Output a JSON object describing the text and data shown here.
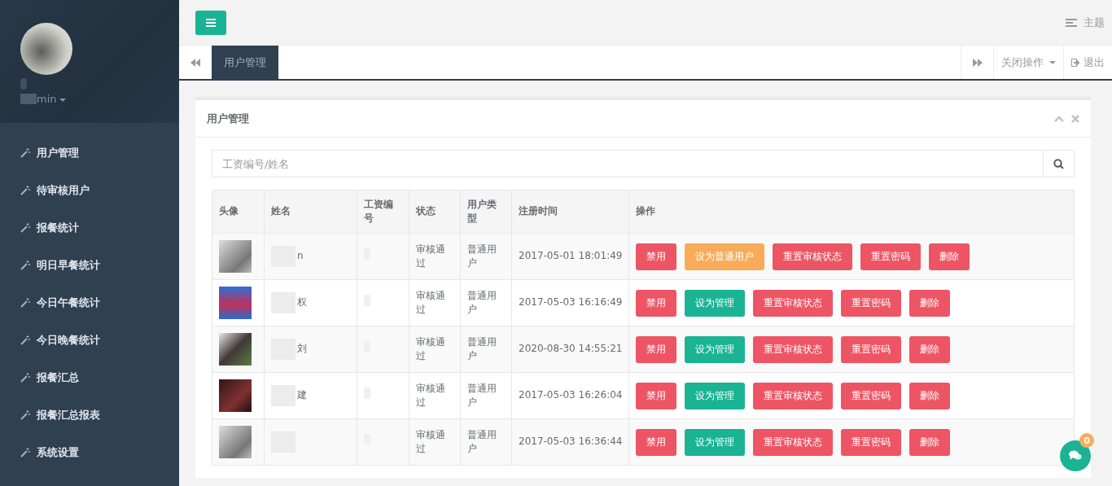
{
  "sidebar": {
    "username": "min",
    "menu": [
      {
        "label": "用户管理"
      },
      {
        "label": "待审核用户"
      },
      {
        "label": "报餐统计"
      },
      {
        "label": "明日早餐统计"
      },
      {
        "label": "今日午餐统计"
      },
      {
        "label": "今日晚餐统计"
      },
      {
        "label": "报餐汇总"
      },
      {
        "label": "报餐汇总报表"
      },
      {
        "label": "系统设置"
      }
    ]
  },
  "topbar": {
    "theme_label": "主题"
  },
  "tabs": [
    {
      "label": "用户管理",
      "selected": true
    }
  ],
  "tab_actions": {
    "close_ops": "关闭操作",
    "logout": "退出"
  },
  "panel": {
    "title": "用户管理",
    "search": {
      "placeholder": "工资编号/姓名"
    },
    "table": {
      "columns": [
        "头像",
        "姓名",
        "工资编号",
        "状态",
        "用户类型",
        "注册时间",
        "操作"
      ],
      "rows": [
        {
          "name": "n",
          "status": "审核通过",
          "type": "普通用户",
          "time": "2017-05-01 18:01:49",
          "actions": [
            {
              "label": "禁用",
              "kind": "danger"
            },
            {
              "label": "设为普通用户",
              "kind": "warning"
            },
            {
              "label": "重置审核状态",
              "kind": "danger"
            },
            {
              "label": "重置密码",
              "kind": "danger"
            },
            {
              "label": "删除",
              "kind": "danger"
            }
          ]
        },
        {
          "name": "权",
          "status": "审核通过",
          "type": "普通用户",
          "time": "2017-05-03 16:16:49",
          "actions": [
            {
              "label": "禁用",
              "kind": "danger"
            },
            {
              "label": "设为管理",
              "kind": "primary"
            },
            {
              "label": "重置审核状态",
              "kind": "danger"
            },
            {
              "label": "重置密码",
              "kind": "danger"
            },
            {
              "label": "删除",
              "kind": "danger"
            }
          ]
        },
        {
          "name": "刘",
          "status": "审核通过",
          "type": "普通用户",
          "time": "2020-08-30 14:55:21",
          "actions": [
            {
              "label": "禁用",
              "kind": "danger"
            },
            {
              "label": "设为管理",
              "kind": "primary"
            },
            {
              "label": "重置审核状态",
              "kind": "danger"
            },
            {
              "label": "重置密码",
              "kind": "danger"
            },
            {
              "label": "删除",
              "kind": "danger"
            }
          ]
        },
        {
          "name": "建",
          "status": "审核通过",
          "type": "普通用户",
          "time": "2017-05-03 16:26:04",
          "actions": [
            {
              "label": "禁用",
              "kind": "danger"
            },
            {
              "label": "设为管理",
              "kind": "primary"
            },
            {
              "label": "重置审核状态",
              "kind": "danger"
            },
            {
              "label": "重置密码",
              "kind": "danger"
            },
            {
              "label": "删除",
              "kind": "danger"
            }
          ]
        },
        {
          "name": "",
          "status": "审核通过",
          "type": "普通用户",
          "time": "2017-05-03 16:36:44",
          "actions": [
            {
              "label": "禁用",
              "kind": "danger"
            },
            {
              "label": "设为管理",
              "kind": "primary"
            },
            {
              "label": "重置审核状态",
              "kind": "danger"
            },
            {
              "label": "重置密码",
              "kind": "danger"
            },
            {
              "label": "删除",
              "kind": "danger"
            }
          ]
        }
      ]
    }
  },
  "chat_badge": "0"
}
